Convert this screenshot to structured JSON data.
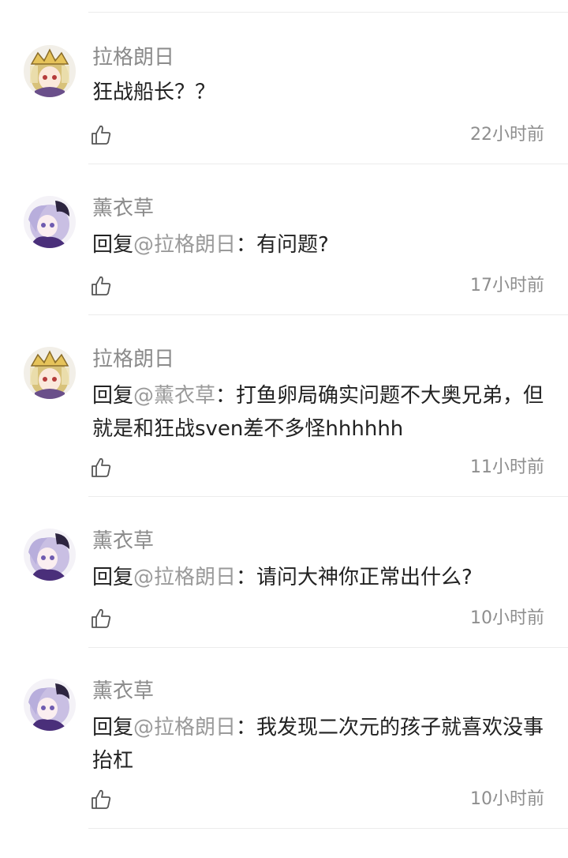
{
  "comments": [
    {
      "user": "拉格朗日",
      "avatar_icon": "anime-girl-blonde-crown-avatar",
      "reply_prefix": "",
      "mention": "",
      "separator": "",
      "text": "狂战船长？？",
      "time": "22小时前"
    },
    {
      "user": "薰衣草",
      "avatar_icon": "anime-girl-lavender-hair-avatar",
      "reply_prefix": "回复",
      "mention": "@拉格朗日",
      "separator": "：",
      "text": "有问题?",
      "time": "17小时前"
    },
    {
      "user": "拉格朗日",
      "avatar_icon": "anime-girl-blonde-crown-avatar",
      "reply_prefix": "回复",
      "mention": "@薰衣草",
      "separator": "：",
      "text": "打鱼卵局确实问题不大奥兄弟，但就是和狂战sven差不多怪hhhhhh",
      "time": "11小时前"
    },
    {
      "user": "薰衣草",
      "avatar_icon": "anime-girl-lavender-hair-avatar",
      "reply_prefix": "回复",
      "mention": "@拉格朗日",
      "separator": "：",
      "text": "请问大神你正常出什么?",
      "time": "10小时前"
    },
    {
      "user": "薰衣草",
      "avatar_icon": "anime-girl-lavender-hair-avatar",
      "reply_prefix": "回复",
      "mention": "@拉格朗日",
      "separator": "：",
      "text": "我发现二次元的孩子就喜欢没事抬杠",
      "time": "10小时前"
    }
  ],
  "icons": {
    "like": "thumbs-up-icon"
  },
  "colors": {
    "username": "#8b8b8b",
    "mention": "#9a9a9a",
    "text": "#222222",
    "time": "#8e8e8e",
    "divider": "#ececec"
  }
}
